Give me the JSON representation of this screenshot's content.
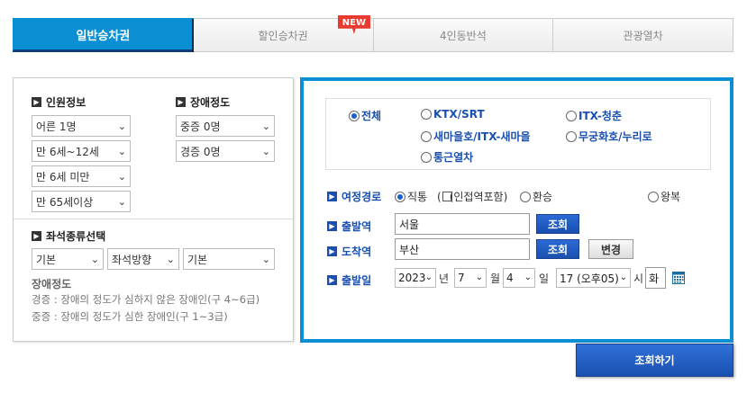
{
  "tabs": [
    {
      "label": "일반승차권",
      "active": true
    },
    {
      "label": "할인승차권",
      "badge": "NEW"
    },
    {
      "label": "4인동반석"
    },
    {
      "label": "관광열차"
    }
  ],
  "passenger": {
    "title": "인원정보",
    "adult": "어른 1명",
    "child": "만 6세~12세",
    "infant": "만 6세 미만",
    "senior": "만 65세이상"
  },
  "disability": {
    "title": "장애정도",
    "severe": "중증 0명",
    "mild": "경증 0명"
  },
  "seat": {
    "title": "좌석종류선택",
    "type": "기본",
    "direction": "좌석방향",
    "position": "기본"
  },
  "disability_note": {
    "heading": "장애정도",
    "mild": "경증 : 장애의 정도가 심하지 않은 장애인(구 4~6급)",
    "severe": "중증 : 장애의 정도가 심한 장애인(구 1~3급)"
  },
  "train_types": [
    {
      "label": "전체",
      "selected": true
    },
    {
      "label": "KTX/SRT"
    },
    {
      "label": "ITX-청춘"
    },
    {
      "label": "새마을호/ITX-새마을"
    },
    {
      "label": "무궁화호/누리로"
    },
    {
      "label": "통근열차"
    }
  ],
  "route": {
    "label": "여정경로",
    "direct": "직통",
    "include_nearby": "(인접역포함)",
    "transfer": "환승",
    "round_trip": "왕복"
  },
  "departure": {
    "label": "출발역",
    "value": "서울",
    "button": "조회"
  },
  "arrival": {
    "label": "도착역",
    "value": "부산",
    "button": "조회",
    "swap": "변경"
  },
  "date": {
    "label": "출발일",
    "year": "2023",
    "year_unit": "년",
    "month": "7",
    "month_unit": "월",
    "day": "4",
    "day_unit": "일",
    "hour": "17 (오후05)",
    "hour_unit": "시",
    "weekday": "화"
  },
  "search_button": "조회하기",
  "colors": {
    "accent": "#0a8fd4",
    "button": "#1a4fb0",
    "badge": "#e83a2e"
  }
}
